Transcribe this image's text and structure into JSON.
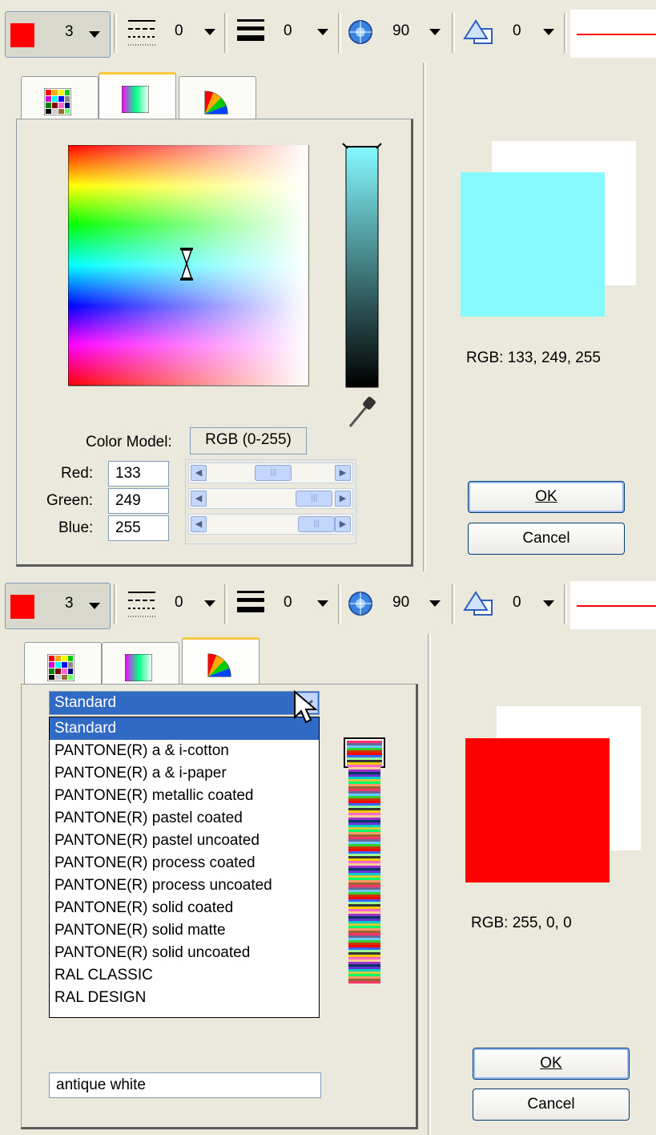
{
  "toolbar": {
    "line_width": "3",
    "dash_value": "0",
    "thickness_value": "0",
    "angle_value": "90",
    "shape_value": "0"
  },
  "top_dialog": {
    "tabs": [
      "palette-grid-icon",
      "gradient-icon",
      "color-wheel-icon"
    ],
    "color_model_label": "Color Model:",
    "color_model_value": "RGB (0-255)",
    "red_label": "Red:",
    "green_label": "Green:",
    "blue_label": "Blue:",
    "red_value": "133",
    "green_value": "249",
    "blue_value": "255",
    "sliders": {
      "red": 0.52,
      "green": 0.976,
      "blue": 1.0
    },
    "preview_color": "#85f9ff",
    "rgb_readout": "RGB: 133, 249, 255",
    "ok_label": "OK",
    "cancel_label": "Cancel"
  },
  "bottom_dialog": {
    "palette_selected": "Standard",
    "palette_options": [
      "Standard",
      "PANTONE(R) a & i-cotton",
      "PANTONE(R) a & i-paper",
      "PANTONE(R) metallic coated",
      "PANTONE(R) pastel coated",
      "PANTONE(R) pastel uncoated",
      "PANTONE(R) process coated",
      "PANTONE(R) process uncoated",
      "PANTONE(R) solid coated",
      "PANTONE(R) solid matte",
      "PANTONE(R) solid uncoated",
      "RAL CLASSIC",
      "RAL DESIGN"
    ],
    "color_name": "antique white",
    "preview_color": "#ff0000",
    "rgb_readout": "RGB: 255, 0, 0",
    "ok_label": "OK",
    "cancel_label": "Cancel"
  },
  "colors": {
    "accent": "#316ac5",
    "current_color": "#ff0000"
  }
}
